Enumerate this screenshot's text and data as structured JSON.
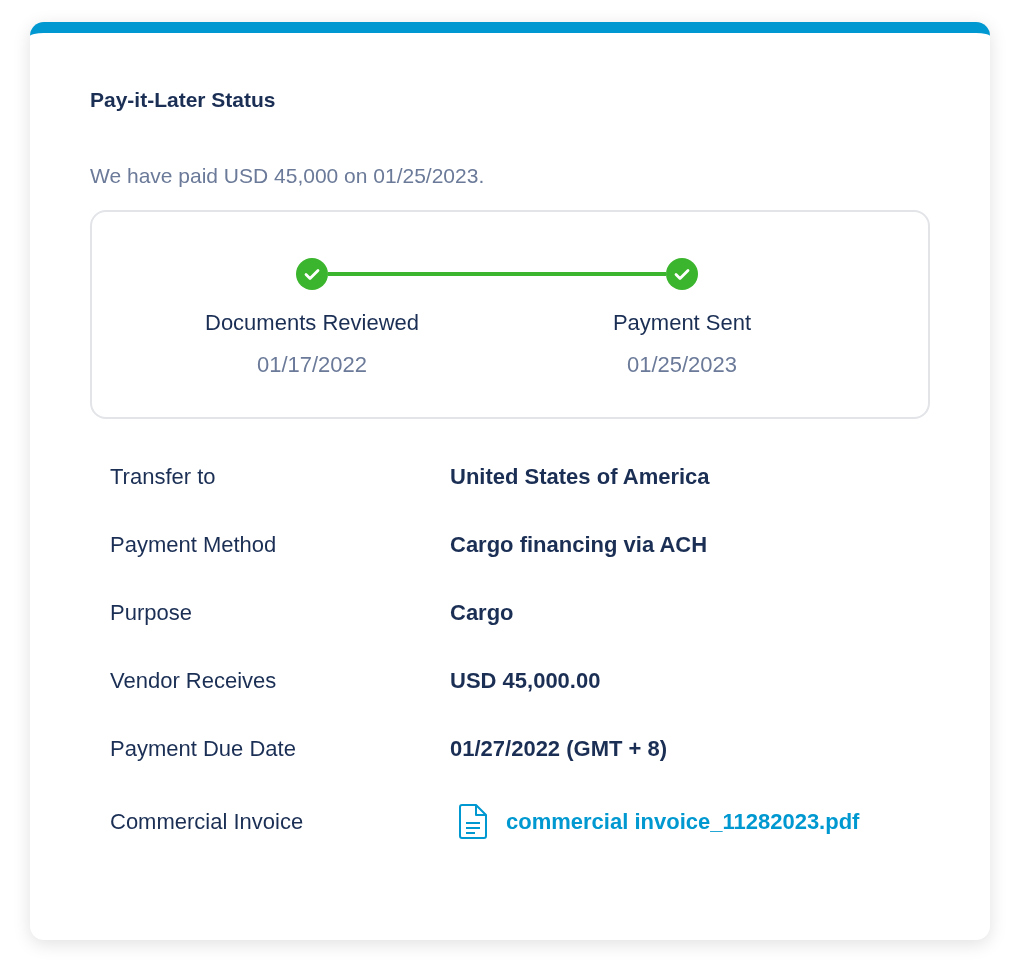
{
  "card": {
    "title": "Pay-it-Later Status",
    "summary": "We have paid USD 45,000 on 01/25/2023."
  },
  "steps": [
    {
      "label": "Documents Reviewed",
      "date": "01/17/2022",
      "done": true
    },
    {
      "label": "Payment Sent",
      "date": "01/25/2023",
      "done": true
    }
  ],
  "details": [
    {
      "label": "Transfer to",
      "value": "United States of America",
      "kind": "text"
    },
    {
      "label": "Payment Method",
      "value": "Cargo financing via ACH",
      "kind": "text"
    },
    {
      "label": "Purpose",
      "value": "Cargo",
      "kind": "text"
    },
    {
      "label": "Vendor Receives",
      "value": "USD 45,000.00",
      "kind": "text"
    },
    {
      "label": "Payment Due Date",
      "value": "01/27/2022 (GMT + 8)",
      "kind": "text"
    },
    {
      "label": "Commercial Invoice",
      "value": "commercial invoice_11282023.pdf",
      "kind": "file"
    }
  ]
}
